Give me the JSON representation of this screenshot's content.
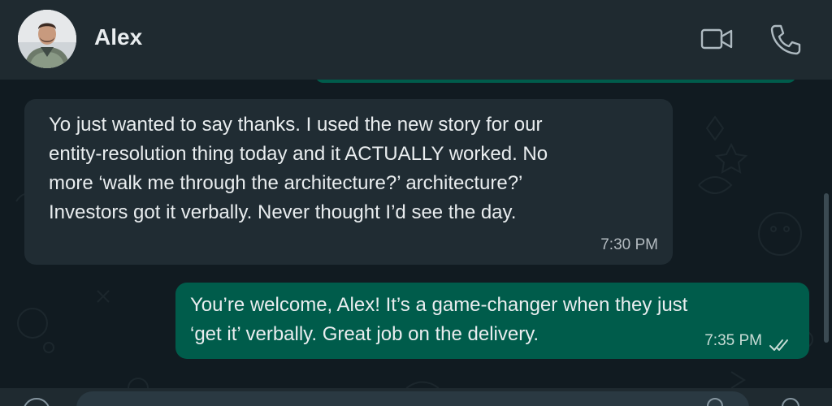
{
  "contact": {
    "name": "Alex"
  },
  "header": {
    "icons": [
      "video-call-icon",
      "voice-call-icon"
    ]
  },
  "messages": [
    {
      "direction": "incoming",
      "text": "Yo just wanted to say thanks. I used the new story for our\nentity-resolution thing today and it ACTUALLY worked. No\nmore ‘walk me through the architecture?’ architecture?’\nInvestors got it verbally. Never thought I’d see the day.",
      "time": "7:30 PM"
    },
    {
      "direction": "outgoing",
      "text": "You’re welcome, Alex! It’s a game-changer when they just\n‘get it’ verbally. Great job on the delivery.",
      "time": "7:35 PM",
      "status": "read"
    }
  ],
  "colors": {
    "header_bg": "#1f2a30",
    "chat_bg": "#111b21",
    "incoming_bubble": "#202c33",
    "outgoing_bubble": "#005c4b",
    "read_ticks": "#c8dcd6"
  }
}
